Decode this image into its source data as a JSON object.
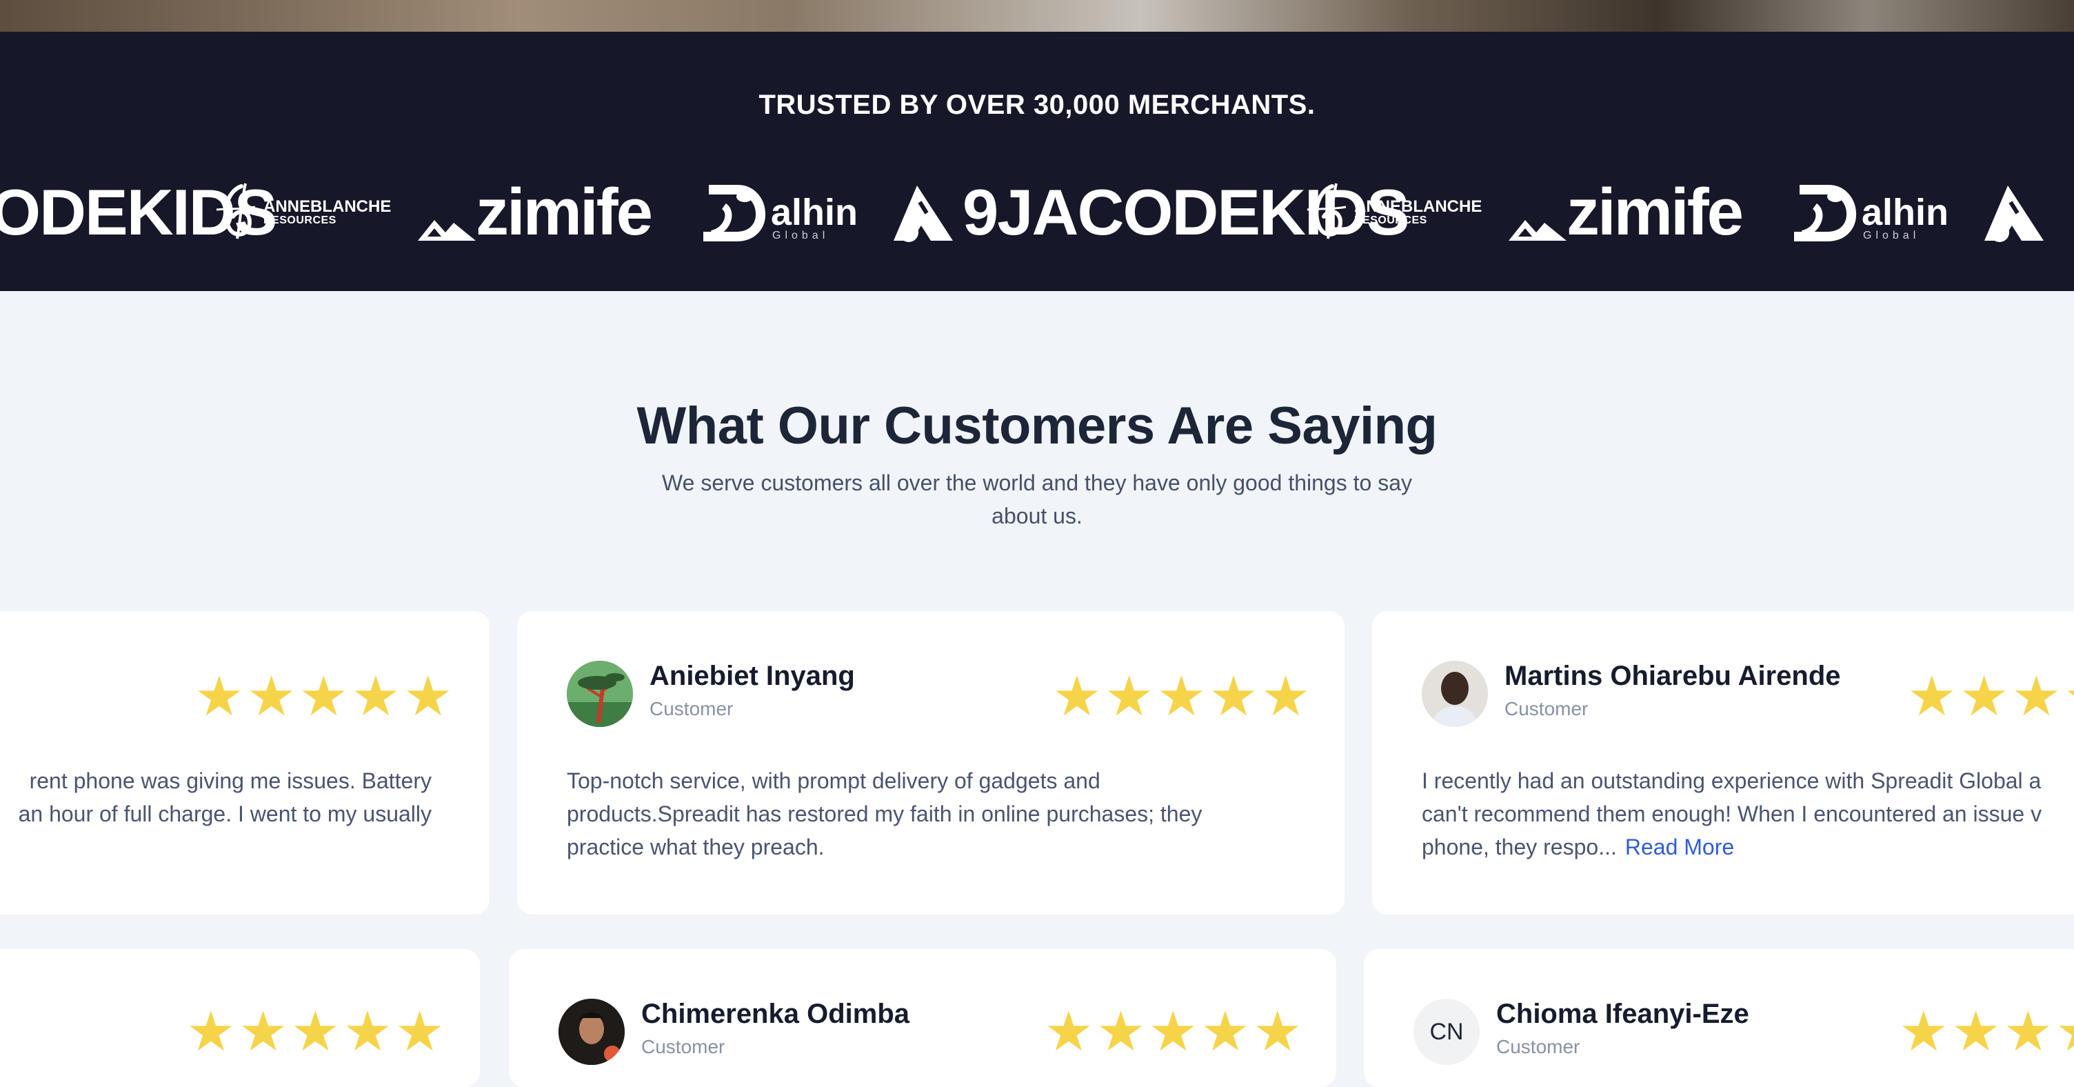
{
  "merchants": {
    "title": "TRUSTED BY OVER 30,000 MERCHANTS.",
    "logos": [
      {
        "name": "9jacodekids",
        "text": "9JACODEKIDS",
        "partial_text": "ODEKIDS"
      },
      {
        "name": "anneblanche",
        "line1": "ANNEBLANCHE",
        "line2": "RESOURCES"
      },
      {
        "name": "zimife",
        "text": "zimife"
      },
      {
        "name": "dalhin",
        "text": "alhin",
        "sub": "Global"
      }
    ]
  },
  "testimonials": {
    "title": "What Our Customers Are Saying",
    "subtitle_line1": "We serve customers all over the world and they have only good things to say",
    "subtitle_line2": "about us.",
    "star_glyph": "★",
    "star_color": "#f6d44a",
    "row1": [
      {
        "name": "",
        "role": "",
        "rating": 5,
        "review_line1": "rent phone was giving me issues. Battery",
        "review_line2": "an hour of full charge. I went to my usually",
        "review_line3": ""
      },
      {
        "name": "Aniebiet Inyang",
        "role": "Customer",
        "rating": 5,
        "review_line1": "Top-notch service, with prompt delivery of gadgets and",
        "review_line2": "products.Spreadit has restored my faith in online purchases; they",
        "review_line3": "practice what they preach."
      },
      {
        "name": "Martins Ohiarebu Airende",
        "role": "Customer",
        "rating": 5,
        "review_line1": "I recently had an outstanding experience with Spreadit Global a",
        "review_line2": "can't recommend them enough! When I encountered an issue v",
        "review_line3": "phone, they respo...",
        "read_more": "Read More"
      }
    ],
    "row2": [
      {
        "name": "",
        "role": "",
        "rating": 5
      },
      {
        "name": "Chimerenka Odimba",
        "role": "Customer",
        "rating": 5
      },
      {
        "name": "Chioma Ifeanyi-Eze",
        "role": "Customer",
        "rating": 5,
        "initials": "CN"
      }
    ]
  }
}
